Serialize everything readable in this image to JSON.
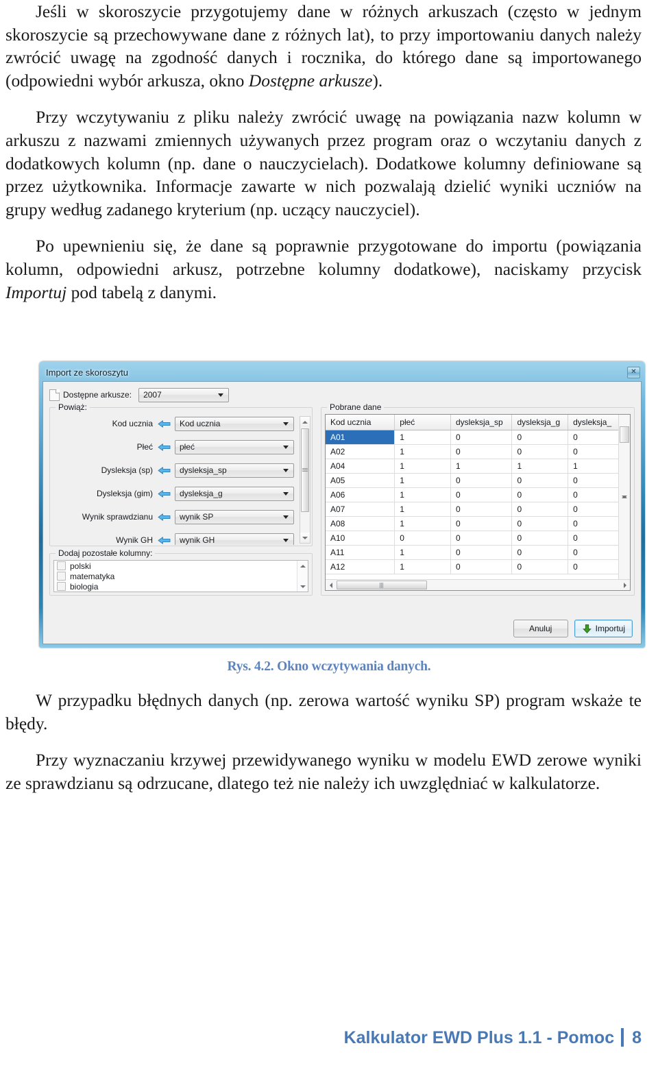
{
  "document": {
    "paragraphs": [
      {
        "id": "p1",
        "runs": [
          {
            "text": "Jeśli w skoroszycie przygotujemy dane w różnych arkuszach (często w jednym skoroszycie są przechowywane dane z różnych lat), to przy importowaniu danych należy zwrócić uwagę na zgodność danych i rocznika, do którego dane są importowanego (odpowiedni wybór arkusza, okno ",
            "style": "normal"
          },
          {
            "text": "Dostępne arkusze",
            "style": "italic"
          },
          {
            "text": ").",
            "style": "normal"
          }
        ]
      },
      {
        "id": "p2",
        "runs": [
          {
            "text": "Przy wczytywaniu z pliku należy zwrócić uwagę na powiązania nazw kolumn w arkuszu z nazwami zmiennych używanych przez program oraz o wczytaniu danych z dodatkowych kolumn (np. dane o nauczycielach). Dodatkowe kolumny definiowane są przez użytkownika. Informacje zawarte w nich pozwalają dzielić wyniki uczniów na grupy według zadanego kryterium (np. uczący nauczyciel).",
            "style": "normal"
          }
        ]
      },
      {
        "id": "p3",
        "runs": [
          {
            "text": "Po upewnieniu się, że dane są poprawnie przygotowane do importu (powiązania kolumn, odpowiedni arkusz, potrzebne kolumny dodatkowe), naciskamy przycisk ",
            "style": "normal"
          },
          {
            "text": "Importuj",
            "style": "italic"
          },
          {
            "text": " pod tabelą z danymi.",
            "style": "normal"
          }
        ]
      },
      {
        "id": "p4",
        "runs": [
          {
            "text": "W przypadku błędnych danych (np. zerowa wartość wyniku SP) program wskaże te błędy.",
            "style": "normal"
          }
        ]
      },
      {
        "id": "p5",
        "runs": [
          {
            "text": "Przy wyznaczaniu krzywej przewidywanego wyniku w modelu EWD zerowe wyniki ze sprawdzianu są odrzucane, dlatego też nie należy ich uwzględniać w kalkulatorze.",
            "style": "normal"
          }
        ]
      }
    ],
    "figure_caption": "Rys. 4.2. Okno wczytywania danych.",
    "footer": {
      "title": "Kalkulator EWD Plus 1.1 - Pomoc",
      "page_number": "8",
      "color": "#4979b4"
    }
  },
  "dialog": {
    "title": "Import ze skoroszytu",
    "close_label": "✕",
    "sheet_picker": {
      "label": "Dostępne arkusze:",
      "value": "2007",
      "icon": "document-icon"
    },
    "mapping_group": {
      "title": "Powiąż:",
      "rows": [
        {
          "name": "Kod ucznia",
          "value": "Kod ucznia"
        },
        {
          "name": "Płeć",
          "value": "płeć"
        },
        {
          "name": "Dysleksja (sp)",
          "value": "dysleksja_sp"
        },
        {
          "name": "Dysleksja (gim)",
          "value": "dysleksja_g"
        },
        {
          "name": "Wynik sprawdzianu",
          "value": "wynik SP"
        },
        {
          "name": "Wynik GH",
          "value": "wynik GH"
        }
      ]
    },
    "extra_columns_group": {
      "title": "Dodaj pozostałe kolumny:",
      "items": [
        {
          "label": "polski",
          "checked": false
        },
        {
          "label": "matematyka",
          "checked": false
        },
        {
          "label": "biologia",
          "checked": false
        }
      ]
    },
    "data_group": {
      "title": "Pobrane dane",
      "columns": [
        "Kod ucznia",
        "płeć",
        "dysleksja_sp",
        "dysleksja_g",
        "dysleksja_"
      ],
      "rows": [
        {
          "cells": [
            "A01",
            "1",
            "0",
            "0",
            "0"
          ],
          "selected": true
        },
        {
          "cells": [
            "A02",
            "1",
            "0",
            "0",
            "0"
          ],
          "selected": false
        },
        {
          "cells": [
            "A04",
            "1",
            "1",
            "1",
            "1"
          ],
          "selected": false
        },
        {
          "cells": [
            "A05",
            "1",
            "0",
            "0",
            "0"
          ],
          "selected": false
        },
        {
          "cells": [
            "A06",
            "1",
            "0",
            "0",
            "0"
          ],
          "selected": false
        },
        {
          "cells": [
            "A07",
            "1",
            "0",
            "0",
            "0"
          ],
          "selected": false
        },
        {
          "cells": [
            "A08",
            "1",
            "0",
            "0",
            "0"
          ],
          "selected": false
        },
        {
          "cells": [
            "A10",
            "0",
            "0",
            "0",
            "0"
          ],
          "selected": false
        },
        {
          "cells": [
            "A11",
            "1",
            "0",
            "0",
            "0"
          ],
          "selected": false
        },
        {
          "cells": [
            "A12",
            "1",
            "0",
            "0",
            "0"
          ],
          "selected": false
        }
      ]
    },
    "buttons": {
      "cancel": "Anuluj",
      "import": "Importuj"
    },
    "colors": {
      "titlebar_blue": "#2d84b5",
      "selection_blue": "#2a6fb8",
      "arrow_blue": "#4aa3dd",
      "import_icon_green": "#3c9c24"
    }
  }
}
